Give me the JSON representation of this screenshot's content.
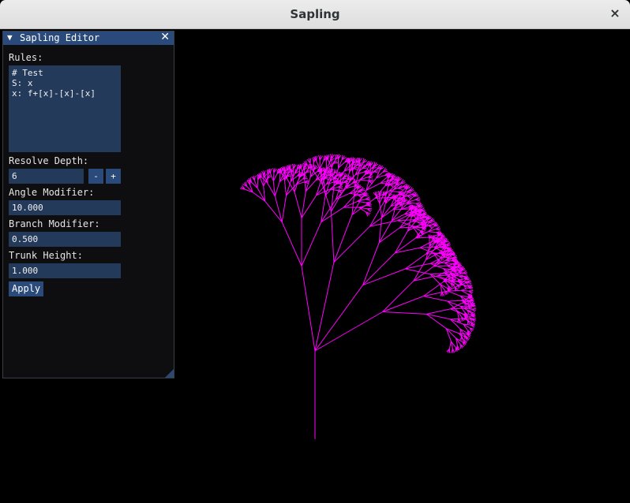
{
  "window": {
    "title": "Sapling",
    "close_glyph": "×"
  },
  "editor": {
    "title": "Sapling Editor",
    "collapse_glyph": "▼",
    "close_glyph": "✕",
    "rules_label": "Rules:",
    "rules_text": "# Test\nS: x\nx: f+[x]-[x]-[x]",
    "resolve_depth_label": "Resolve Depth:",
    "resolve_depth_value": "6",
    "decrement_label": "-",
    "increment_label": "+",
    "angle_modifier_label": "Angle Modifier:",
    "angle_modifier_value": "10.000",
    "branch_modifier_label": "Branch Modifier:",
    "branch_modifier_value": "0.500",
    "trunk_height_label": "Trunk Height:",
    "trunk_height_value": "1.000",
    "apply_label": "Apply"
  },
  "colors": {
    "tree_stroke": "#ff00ff",
    "panel_header": "#294a7a",
    "field_bg": "#233a5b"
  }
}
